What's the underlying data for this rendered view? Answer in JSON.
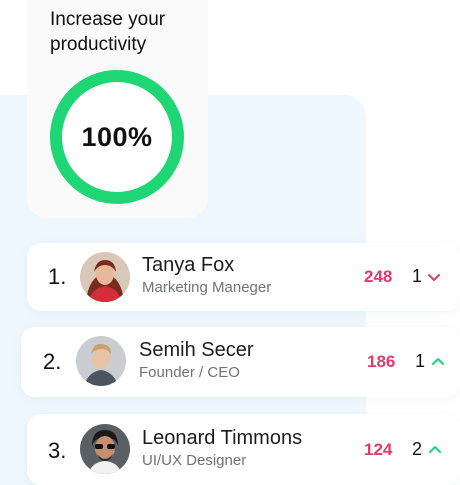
{
  "productivity": {
    "title": "Increase your productivity",
    "value_label": "100%",
    "progress": 1.0,
    "ring_color": "#1fd675"
  },
  "colors": {
    "score": "#e23b6a",
    "up": "#1fd675",
    "down": "#e23b6a"
  },
  "leaderboard": [
    {
      "rank": "1.",
      "name": "Tanya Fox",
      "role": "Marketing Maneger",
      "score": "248",
      "position": "1",
      "trend": "down",
      "avatar_icon": "woman-red-hair-avatar"
    },
    {
      "rank": "2.",
      "name": "Semih Secer",
      "role": "Founder / CEO",
      "score": "186",
      "position": "1",
      "trend": "up",
      "avatar_icon": "man-light-hair-avatar"
    },
    {
      "rank": "3.",
      "name": "Leonard Timmons",
      "role": "UI/UX Designer",
      "score": "124",
      "position": "2",
      "trend": "up",
      "avatar_icon": "man-sunglasses-avatar"
    }
  ]
}
